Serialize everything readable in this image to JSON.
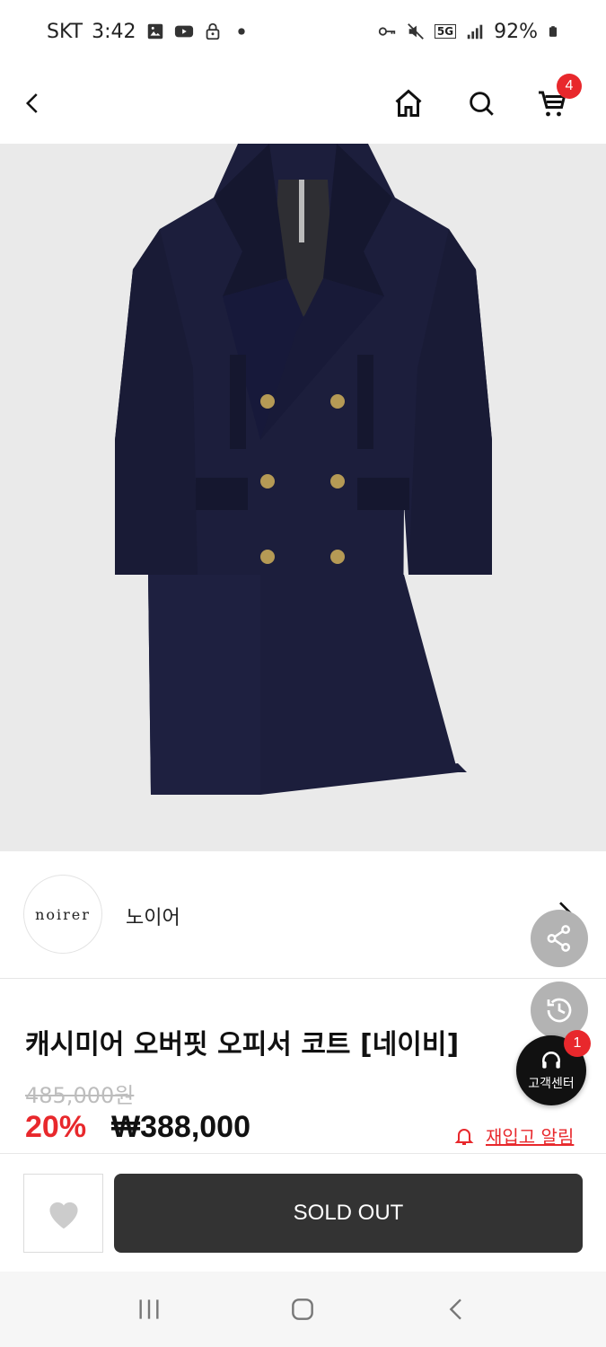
{
  "status_bar": {
    "carrier": "SKT",
    "time": "3:42",
    "network": "5G",
    "battery": "92%",
    "left_icons": [
      "gallery-icon",
      "youtube-icon",
      "lock-icon",
      "dot-icon"
    ],
    "right_icons": [
      "key-icon",
      "mute-icon",
      "5g-icon",
      "signal-icon",
      "battery-icon"
    ]
  },
  "nav": {
    "cart_count": "4"
  },
  "brand": {
    "logo_text": "noirer",
    "name": "노이어"
  },
  "product": {
    "title": "캐시미어 오버핏 오피서 코트 [네이비]",
    "original_price": "485,000원",
    "discount": "20%",
    "price": "₩388,000"
  },
  "restock": {
    "label": "재입고 알림"
  },
  "help": {
    "label": "고객센터",
    "badge": "1"
  },
  "actions": {
    "soldout_label": "SOLD OUT"
  },
  "colors": {
    "accent_red": "#e8282c",
    "button_dark": "#333333",
    "hero_bg": "#eaeaea"
  }
}
